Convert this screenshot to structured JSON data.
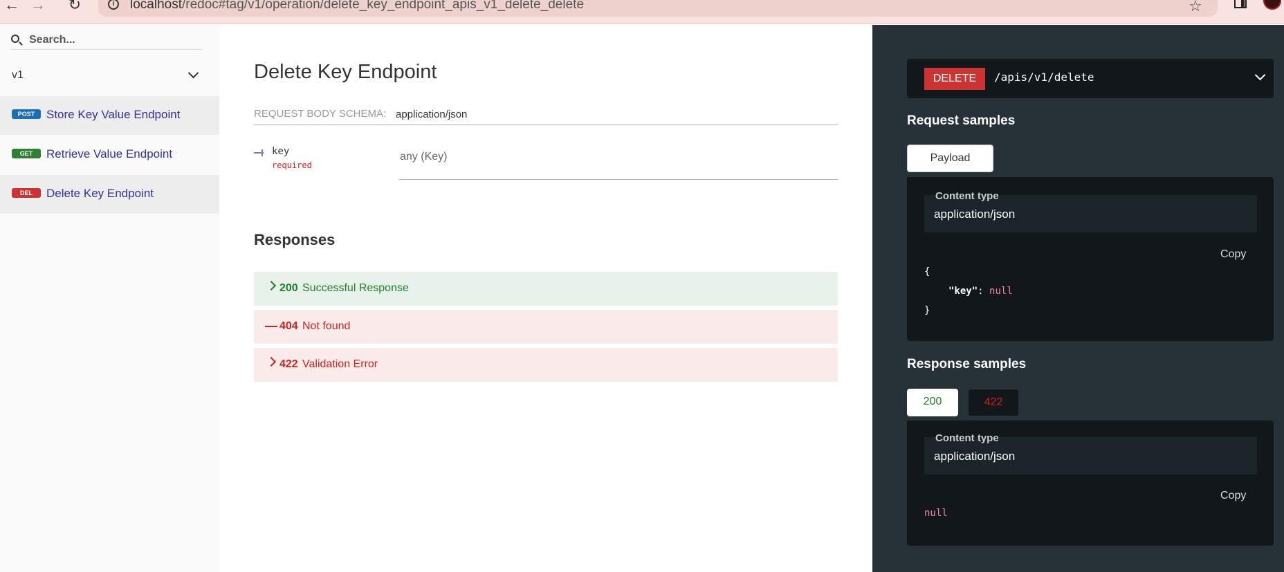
{
  "browser": {
    "url_host": "localhost",
    "url_path": "/redoc#tag/v1/operation/delete_key_endpoint_apis_v1_delete_delete"
  },
  "sidebar": {
    "search_placeholder": "Search...",
    "group_label": "v1",
    "items": [
      {
        "method": "POST",
        "label": "Store Key Value Endpoint"
      },
      {
        "method": "GET",
        "label": "Retrieve Value Endpoint"
      },
      {
        "method": "DEL",
        "label": "Delete Key Endpoint"
      }
    ]
  },
  "operation": {
    "title": "Delete Key Endpoint",
    "request_body_label": "Request Body schema:",
    "request_body_type": "application/json",
    "property": {
      "name": "key",
      "required": "required",
      "type": "any (Key)"
    },
    "responses_title": "Responses",
    "responses": [
      {
        "code": "200",
        "description": "Successful Response"
      },
      {
        "code": "404",
        "description": "Not found"
      },
      {
        "code": "422",
        "description": "Validation Error"
      }
    ]
  },
  "right_panel": {
    "verb": "DELETE",
    "path": "/apis/v1/delete",
    "request_samples_title": "Request samples",
    "payload_tab": "Payload",
    "content_type_label": "Content type",
    "content_type": "application/json",
    "copy_label": "Copy",
    "request_code": {
      "open": "{",
      "key": "\"key\"",
      "colon": ":",
      "value": "null",
      "close": "}"
    },
    "response_samples_title": "Response samples",
    "response_tabs": [
      "200",
      "422"
    ],
    "response_code": "null"
  },
  "colors": {
    "post": "#186fb5",
    "get": "#2f8132",
    "delete": "#cc3333",
    "success": "#1d8127",
    "error": "#d41f1c",
    "link": "#32329f",
    "dark_panel": "#263238"
  }
}
